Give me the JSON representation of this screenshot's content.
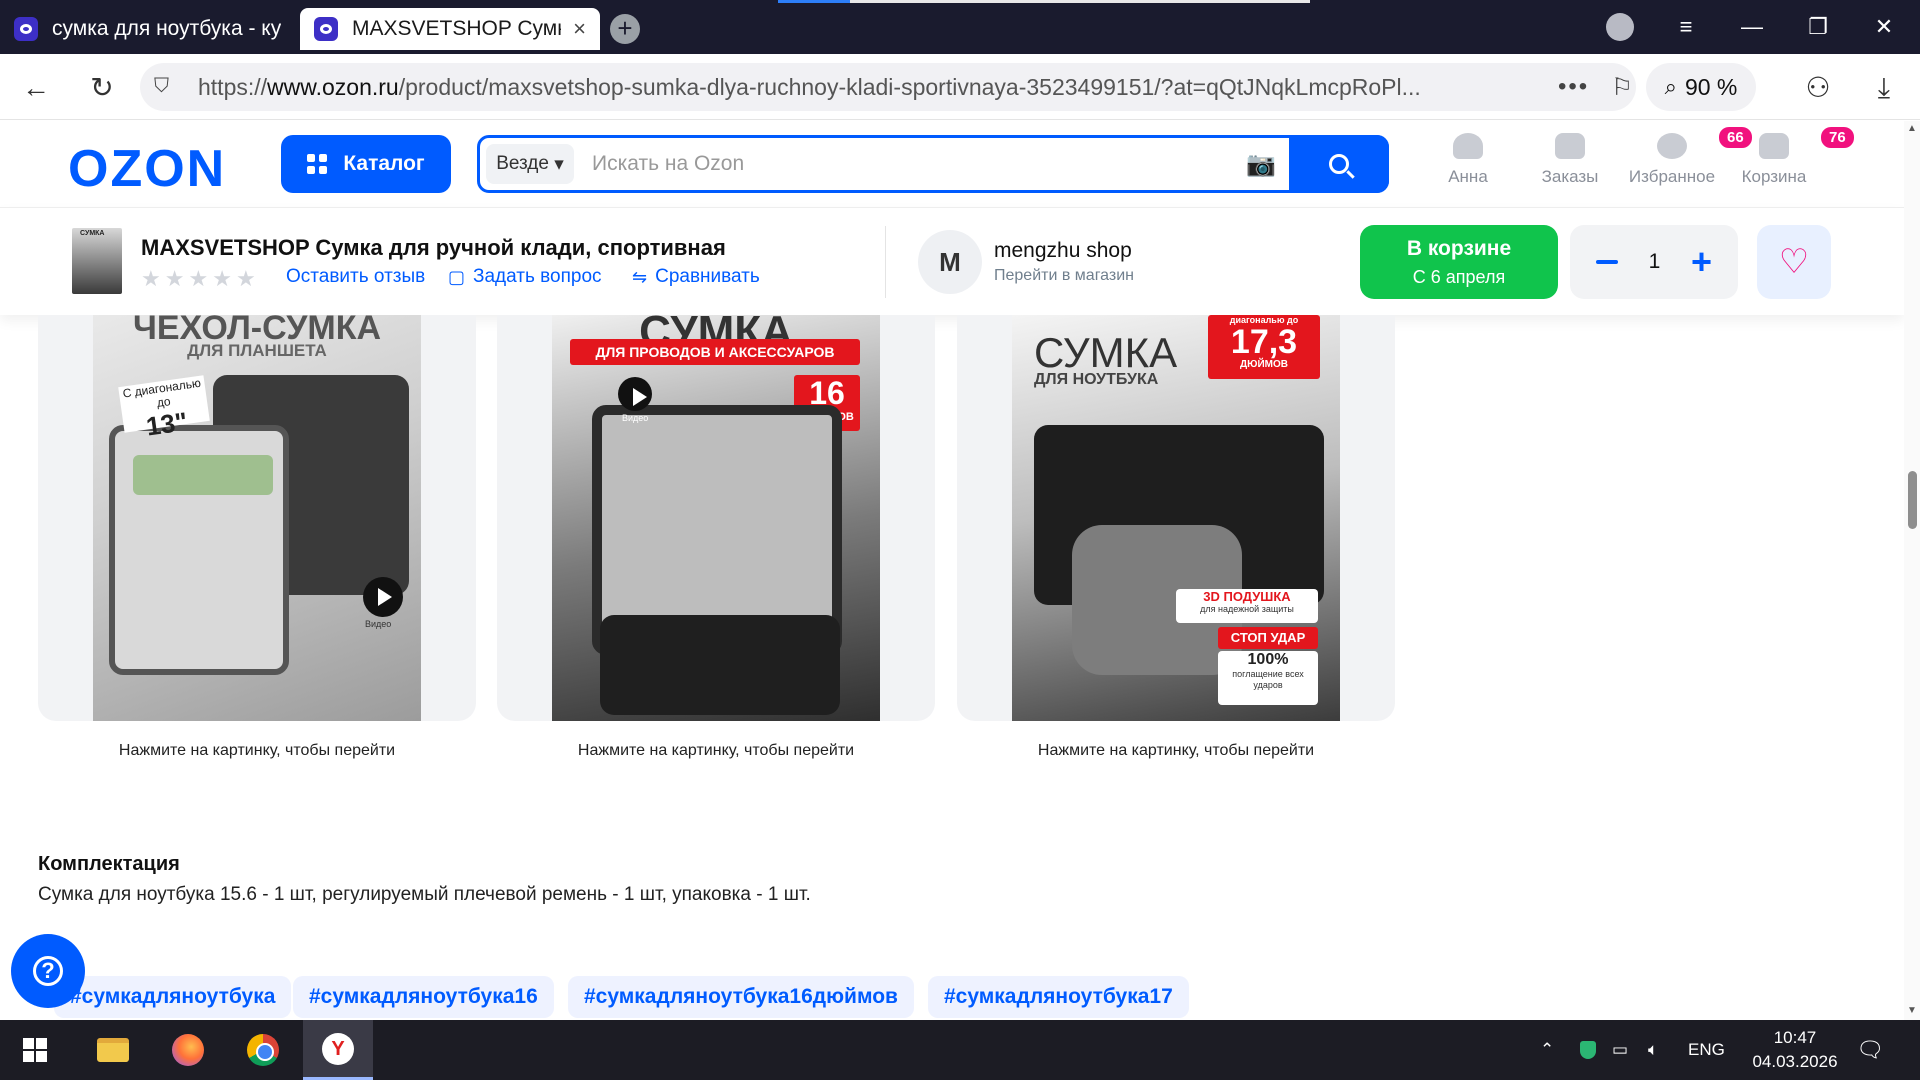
{
  "browser": {
    "tabs": [
      {
        "title": "сумка для ноутбука - купить"
      },
      {
        "title": "MAXSVETSHOP Сумка для",
        "close": "×"
      }
    ],
    "new_tab": "+",
    "url_prefix": "https://",
    "url_domain": "www.ozon.ru",
    "url_path": "/product/maxsvetshop-sumka-dlya-ruchnoy-kladi-sportivnaya-3523499151/?at=qQtJNqkLmcpRoPl...",
    "zoom": "90 %",
    "more": "•••"
  },
  "header": {
    "logo": "OZON",
    "catalog_label": "Каталог",
    "search_scope": "Везде",
    "search_placeholder": "Искать на Ozon",
    "nav": [
      {
        "label": "Анна"
      },
      {
        "label": "Заказы"
      },
      {
        "label": "Избранное",
        "badge": "66"
      },
      {
        "label": "Корзина",
        "badge": "76"
      }
    ]
  },
  "sticky": {
    "thumb_text": "СУМКА",
    "title": "MAXSVETSHOP Сумка для ручной клади, спортивная",
    "rating_stars": 0,
    "review_link": "Оставить отзыв",
    "question_link": "Задать вопрос",
    "compare_link": "Сравнивать",
    "shop_initial": "M",
    "shop_name": "mengzhu shop",
    "shop_link": "Перейти в магазин",
    "cart_label": "В корзине",
    "cart_sub": "С 6 апреля",
    "quantity": "1"
  },
  "cards": [
    {
      "caption": "Нажмите на картинку, чтобы перейти",
      "heading": "ЧЕХОЛ-СУМКА",
      "sub": "ДЛЯ ПЛАНШЕТА",
      "diag_small": "С диагональю до",
      "diag": "13\"",
      "video": "Видео"
    },
    {
      "caption": "Нажмите на картинку, чтобы перейти",
      "heading": "СУМКА",
      "sub": "ДЛЯ ПРОВОДОВ И АКСЕССУАРОВ",
      "count": "16",
      "count_sub": "ОТСЕКОВ",
      "video": "Видео"
    },
    {
      "caption": "Нажмите на картинку, чтобы перейти",
      "heading": "СУМКА",
      "sub": "ДЛЯ НОУТБУКА",
      "diag_small": "диагональю до",
      "diag": "17,3",
      "diag_unit": "ДЮЙМОВ",
      "tag1": "3D ПОДУШКА",
      "tag1_sub": "для надежной защиты",
      "tag2": "СТОП УДАР",
      "tag3": "100%",
      "tag3_sub": "поглащение всех ударов"
    }
  ],
  "komplektatsiya": {
    "heading": "Комплектация",
    "text": "Сумка для ноутбука 15.6 - 1 шт, регулируемый плечевой ремень - 1 шт, упаковка - 1 шт."
  },
  "hashtags": [
    "#сумкадляноутбука",
    "#сумкадляноутбука16",
    "#сумкадляноутбука16дюймов",
    "#сумкадляноутбука17"
  ],
  "help": "?",
  "taskbar": {
    "lang": "ENG",
    "time": "10:47",
    "date": "04.03.2026"
  },
  "colors": {
    "brand": "#005bff",
    "cart_green": "#10c44c",
    "badge_pink": "#f1117e"
  }
}
